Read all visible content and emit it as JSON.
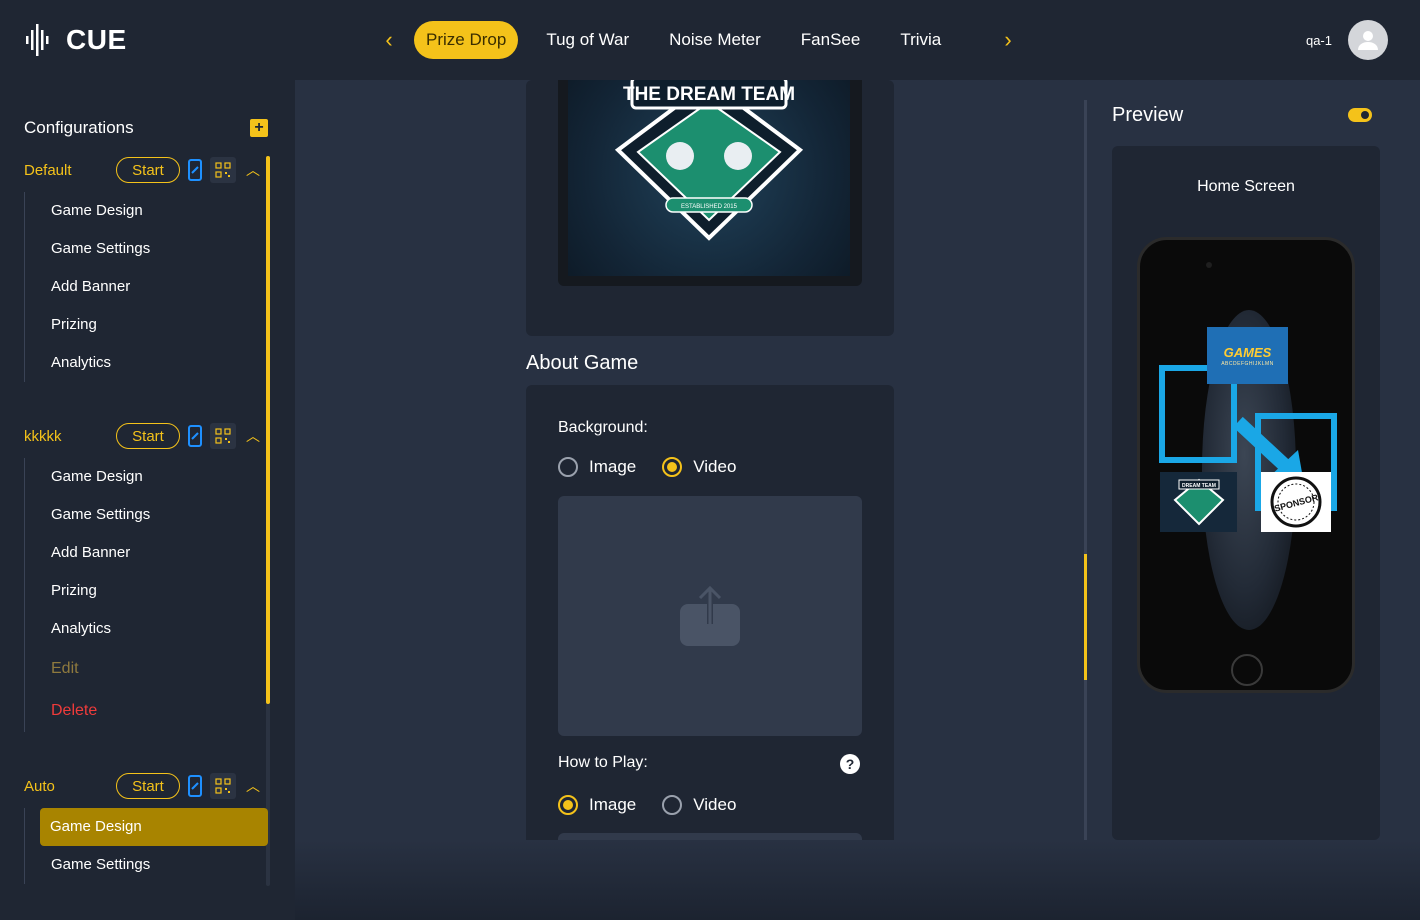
{
  "app": {
    "logo_text": "CUE"
  },
  "nav": {
    "tabs": [
      {
        "label": "Prize Drop",
        "active": true
      },
      {
        "label": "Tug of War",
        "active": false
      },
      {
        "label": "Noise Meter",
        "active": false
      },
      {
        "label": "FanSee",
        "active": false
      },
      {
        "label": "Trivia",
        "active": false
      }
    ]
  },
  "user": {
    "name": "qa-1"
  },
  "sidebar": {
    "title": "Configurations",
    "start_label": "Start",
    "configs": [
      {
        "name": "Default",
        "items": [
          "Game Design",
          "Game Settings",
          "Add Banner",
          "Prizing",
          "Analytics"
        ]
      },
      {
        "name": "kkkkk",
        "items": [
          "Game Design",
          "Game Settings",
          "Add Banner",
          "Prizing",
          "Analytics"
        ],
        "edit_label": "Edit",
        "delete_label": "Delete"
      },
      {
        "name": "Auto",
        "items": [
          "Game Design",
          "Game Settings"
        ],
        "active_item": "Game Design"
      }
    ]
  },
  "main": {
    "banner_text": "THE DREAM TEAM",
    "banner_subtext": "ESTABLISHED 2015",
    "about_title": "About Game",
    "background_label": "Background:",
    "background_options": {
      "image": "Image",
      "video": "Video",
      "selected": "Video"
    },
    "how_to_play_label": "How to Play:",
    "how_to_play_options": {
      "image": "Image",
      "video": "Video",
      "selected": "Image"
    }
  },
  "preview": {
    "title": "Preview",
    "screen_label": "Home Screen",
    "games_tile_text": "GAMES",
    "games_tile_sub": "ABCDEFGHIJKLMN",
    "team_tile_text": "DREAM TEAM",
    "sponsor_text": "SPONSOR",
    "toggle_on": true
  },
  "colors": {
    "accent": "#f4c21a",
    "danger": "#ef3b3b",
    "panel": "#1f2633",
    "main_bg": "#283142"
  }
}
